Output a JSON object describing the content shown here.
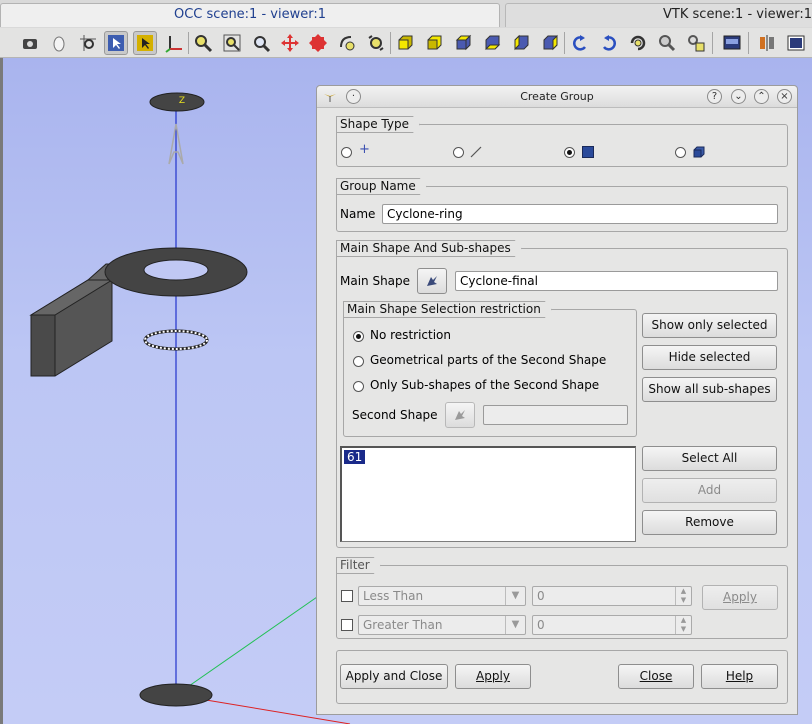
{
  "tabs": {
    "occ": "OCC scene:1 - viewer:1",
    "vtk": "VTK scene:1 - viewer:1"
  },
  "toolbar_icons": [
    "dump-view-icon",
    "mouse-icon",
    "zoom-window-icon",
    "select-icon",
    "select-filter-icon",
    "axes-icon",
    "zoom-icon",
    "fit-all-icon",
    "zoom-area-icon",
    "pan-icon",
    "global-pan-icon",
    "rotate-icon",
    "rotation-point-icon",
    "front-view-icon",
    "back-view-icon",
    "top-view-icon",
    "bottom-view-icon",
    "left-view-icon",
    "right-view-icon",
    "rotate-ccw-icon",
    "rotate-cw-icon",
    "reset-view-icon",
    "clone-view-icon",
    "memorize-view-icon",
    "graduated-axes-icon",
    "trihedron-icon",
    "ambient-icon"
  ],
  "viewer": {
    "axis_z_label": "Z"
  },
  "dialog": {
    "title": "Create Group",
    "shape_type": {
      "legend": "Shape Type",
      "options": [
        "vertex",
        "edge",
        "face",
        "solid"
      ],
      "selected": "face"
    },
    "group_name": {
      "legend": "Group Name",
      "name_label": "Name",
      "name_value": "Cyclone-ring"
    },
    "main_shape": {
      "legend": "Main Shape And Sub-shapes",
      "main_shape_label": "Main Shape",
      "main_shape_value": "Cyclone-final",
      "restriction": {
        "legend": "Main Shape Selection restriction",
        "options": [
          "No restriction",
          "Geometrical parts of the Second Shape",
          "Only Sub-shapes of the Second Shape"
        ],
        "selected": "No restriction",
        "second_shape_label": "Second Shape",
        "second_shape_value": ""
      },
      "show_only_selected": "Show only selected",
      "hide_selected": "Hide selected",
      "show_all_sub_shapes": "Show all sub-shapes",
      "list_items": [
        "61"
      ],
      "select_all": "Select All",
      "add": "Add",
      "remove": "Remove"
    },
    "filter": {
      "legend": "Filter",
      "less_than": "Less Than",
      "less_value": "0",
      "greater_than": "Greater Than",
      "greater_value": "0",
      "apply": "Apply"
    },
    "buttons": {
      "apply_and_close": "Apply and Close",
      "apply": "Apply",
      "close": "Close",
      "help": "Help"
    }
  }
}
